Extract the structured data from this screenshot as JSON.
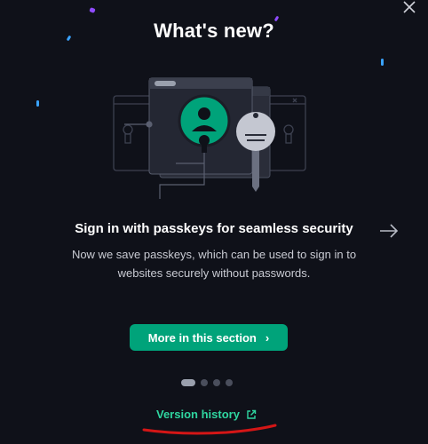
{
  "dialog": {
    "title": "What's new?",
    "close_icon": "close-icon"
  },
  "feature": {
    "title": "Sign in with passkeys for seamless security",
    "description": "Now we save passkeys, which can be used to sign in to websites securely without passwords.",
    "illustration_icons": [
      "user-icon",
      "key-icon",
      "lock-icon"
    ]
  },
  "actions": {
    "more_label": "More in this section",
    "more_icon": "chevron-right-icon",
    "next_icon": "arrow-right-icon",
    "version_history_label": "Version history",
    "version_history_icon": "external-link-icon"
  },
  "pagination": {
    "total": 4,
    "current": 1
  },
  "colors": {
    "background": "#0f1119",
    "accent": "#00a37a",
    "link": "#2fd6a0",
    "annotation": "#d41616"
  }
}
